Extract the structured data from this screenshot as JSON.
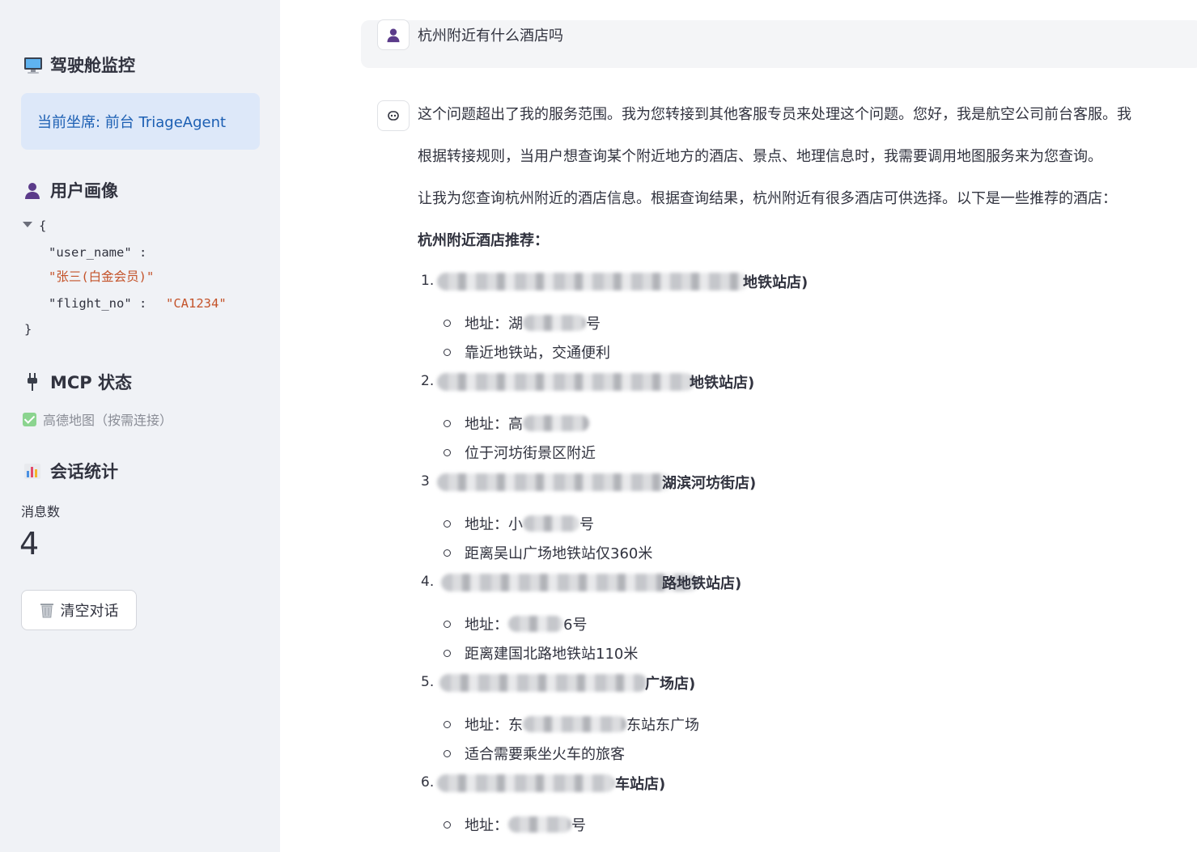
{
  "sidebar": {
    "title": "驾驶舱监控",
    "current_agent": "当前坐席: 前台 TriageAgent",
    "profile_heading": "用户画像",
    "profile": {
      "open_brace": "{",
      "close_brace": "}",
      "user_name_key": "\"user_name\" :",
      "user_name_value": "\"张三(白金会员)\"",
      "flight_no_key": "\"flight_no\" :",
      "flight_no_value": "\"CA1234\""
    },
    "mcp_heading": "MCP 状态",
    "mcp_item": "高德地图（按需连接）",
    "stats_heading": "会话统计",
    "metric_label": "消息数",
    "metric_value": "4",
    "clear_button": "清空对话"
  },
  "chat": {
    "user_message": "杭州附近有什么酒店吗",
    "assistant": {
      "p1": "这个问题超出了我的服务范围。我为您转接到其他客服专员来处理这个问题。您好，我是航空公司前台客服。我",
      "p2": "根据转接规则，当用户想查询某个附近地方的酒店、景点、地理信息时，我需要调用地图服务来为您查询。",
      "p3": "让我为您查询杭州附近的酒店信息。根据查询结果，杭州附近有很多酒店可供选择。以下是一些推荐的酒店：",
      "heading": "杭州附近酒店推荐：",
      "hotels": [
        {
          "num": "1.",
          "name_tail": "地铁站店)",
          "addr_prefix": "地址：湖",
          "addr_suffix": "号",
          "note": "靠近地铁站，交通便利"
        },
        {
          "num": "2.",
          "name_tail": "地铁站店)",
          "addr_prefix": "地址：高",
          "addr_suffix": "",
          "note": "位于河坊街景区附近"
        },
        {
          "num": "3",
          "name_tail": "湖滨河坊街店)",
          "addr_prefix": "地址：小",
          "addr_suffix": "号",
          "note": "距离吴山广场地铁站仅360米"
        },
        {
          "num": "4.",
          "name_tail": "路地铁站店)",
          "addr_prefix": "地址：",
          "addr_suffix": "6号",
          "note": "距离建国北路地铁站110米"
        },
        {
          "num": "5.",
          "name_tail": "广场店)",
          "addr_prefix": "地址：东",
          "addr_suffix": "东站东广场",
          "note": "适合需要乘坐火车的旅客"
        },
        {
          "num": "6.",
          "name_tail": "车站店)",
          "addr_prefix": "地址：",
          "addr_suffix": "号",
          "note": ""
        }
      ]
    }
  },
  "icons": {
    "sidebar_title": "monitor-icon",
    "profile": "user-icon",
    "mcp": "plug-icon",
    "stats": "bar-chart-icon",
    "clear": "trash-icon",
    "user_avatar": "user-avatar-icon",
    "assistant_avatar": "assistant-avatar-icon"
  },
  "colors": {
    "sidebar_bg": "#f0f2f6",
    "agent_box_bg": "#dde8f9",
    "agent_box_text": "#1c5fb3",
    "json_string": "#c4532a",
    "check_green": "#8bd48f"
  }
}
